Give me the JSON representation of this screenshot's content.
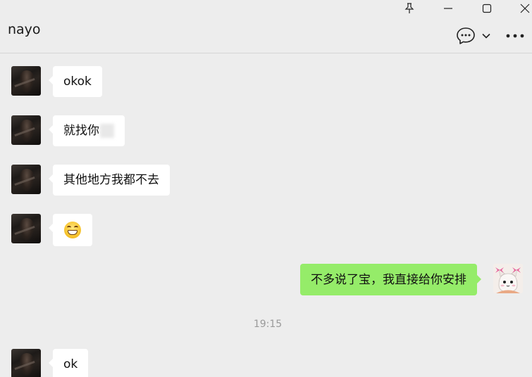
{
  "window": {
    "title": "nayo",
    "buttons": {
      "pin": "pin-icon",
      "minimize": "minimize-icon",
      "maximize": "maximize-icon",
      "close": "close-icon"
    },
    "toolbar": {
      "chat_info": "chat-bubble-icon",
      "dropdown": "chevron-down-icon",
      "more": "more-icon"
    }
  },
  "colors": {
    "background": "#ededed",
    "incoming_bubble": "#ffffff",
    "outgoing_bubble": "#95ec69",
    "timestamp_text": "#9a9a9a"
  },
  "messages": [
    {
      "side": "left",
      "text": "okok"
    },
    {
      "side": "left",
      "text": "就找你",
      "has_blurred_part": true
    },
    {
      "side": "left",
      "text": "其他地方我都不去"
    },
    {
      "side": "left",
      "emoji": "grinning-face-emoji"
    },
    {
      "side": "right",
      "text": "不多说了宝，我直接给你安排"
    },
    {
      "side": "left",
      "text": "ok"
    }
  ],
  "timestamp": "19:15"
}
